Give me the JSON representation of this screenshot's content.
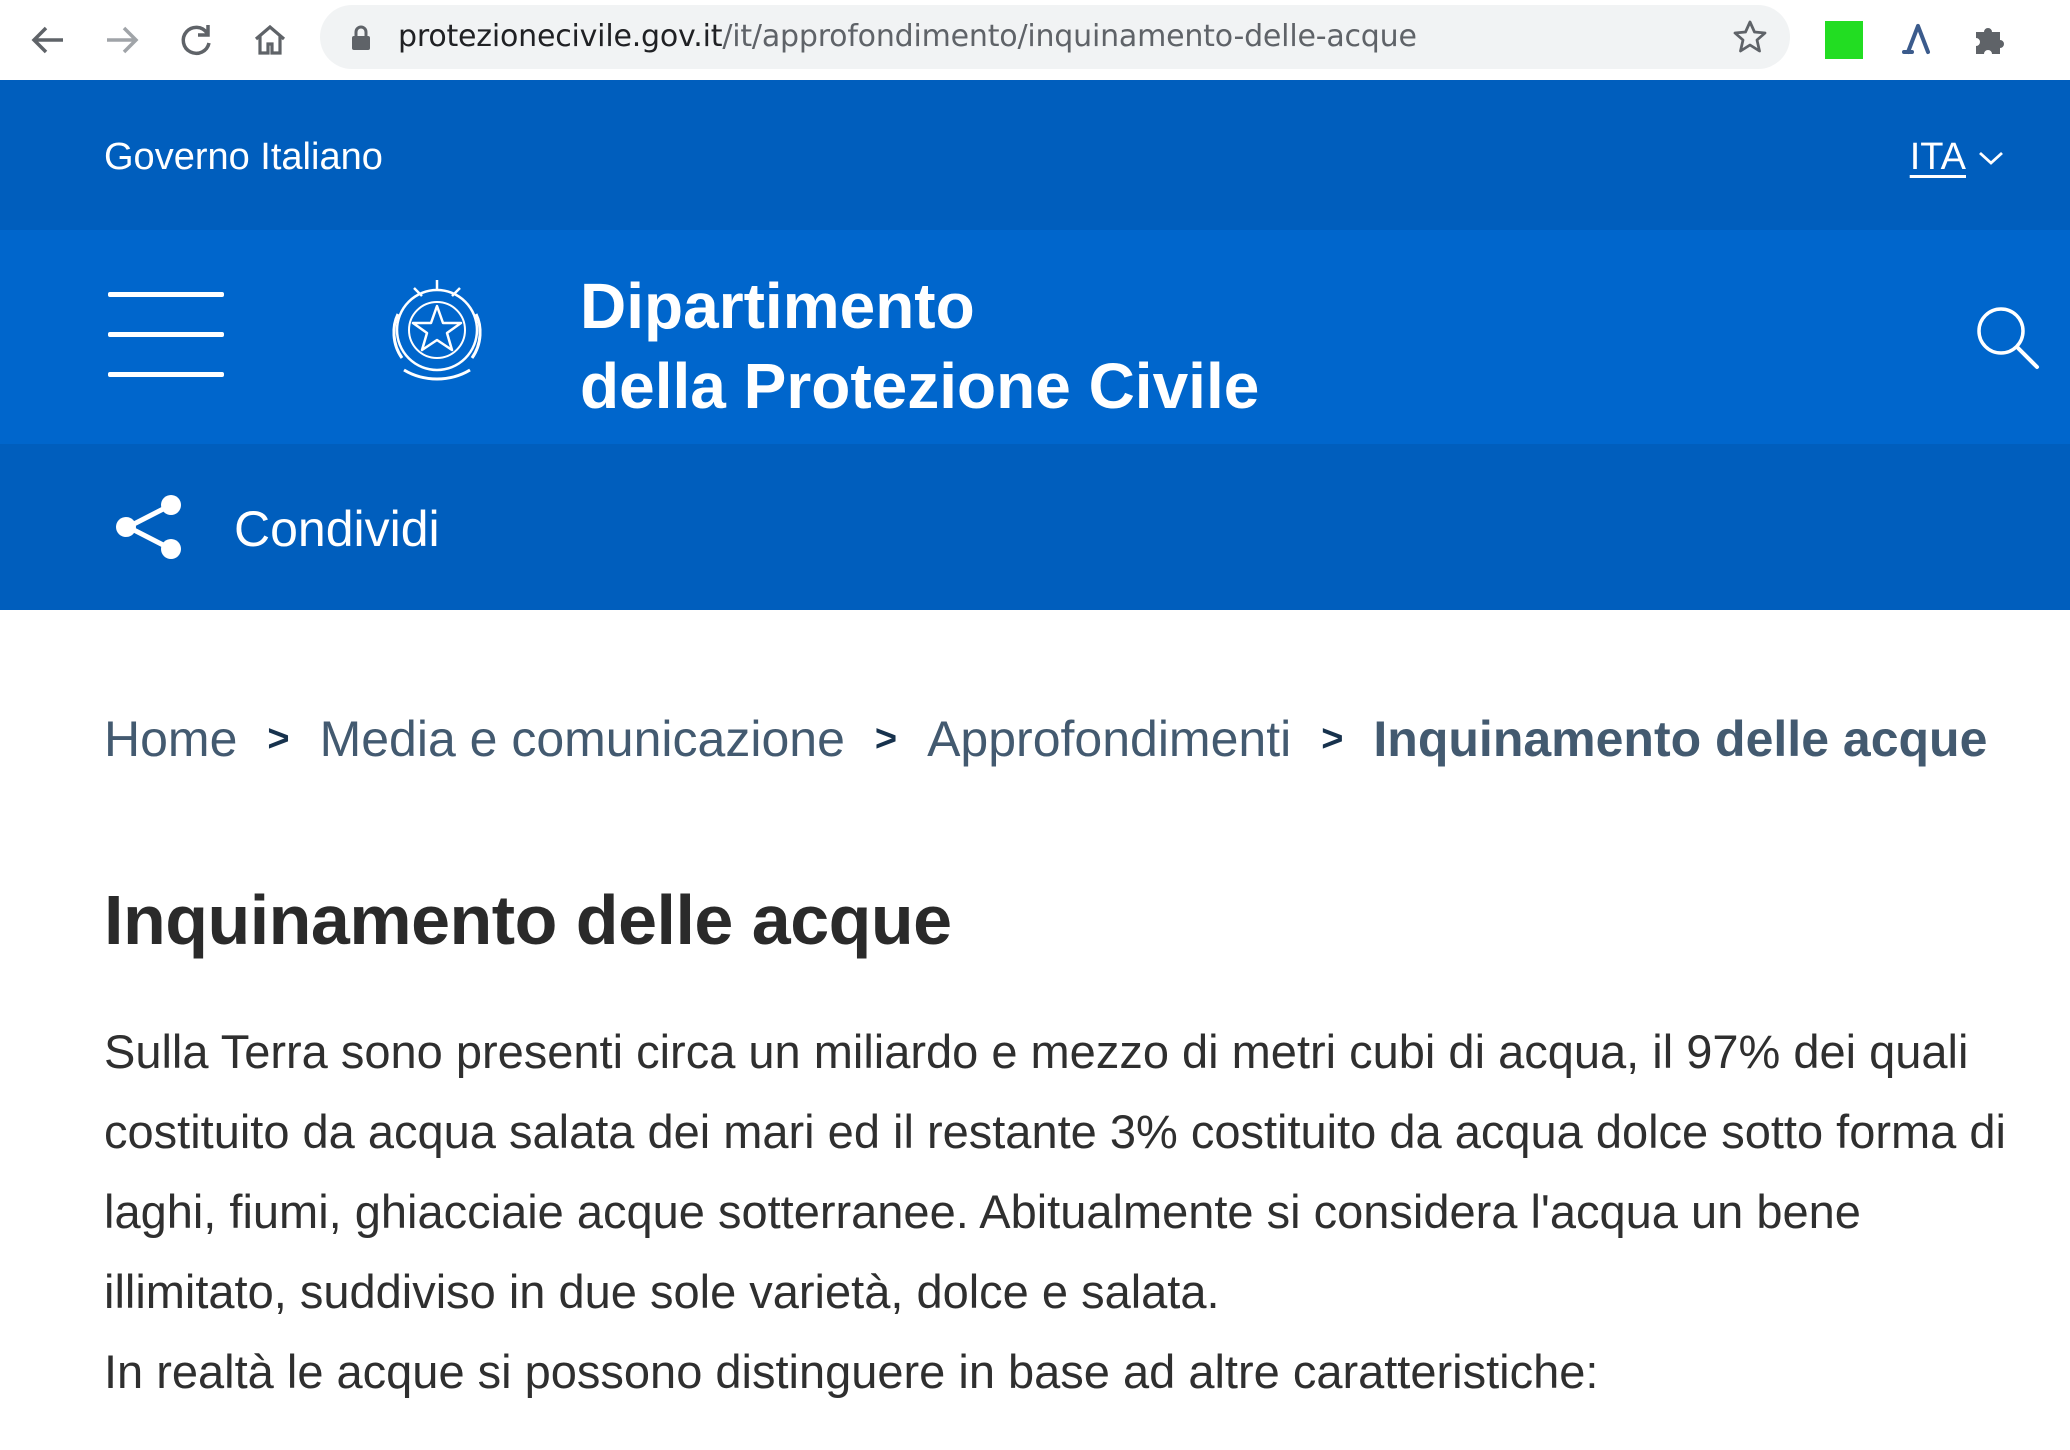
{
  "browser": {
    "url_domain": "protezionecivile.gov.it",
    "url_path": "/it/approfondimento/inquinamento-delle-acque",
    "ext_color": "#22dd22"
  },
  "gov_bar": {
    "label": "Governo Italiano",
    "language": "ITA"
  },
  "header": {
    "title_line1": "Dipartimento",
    "title_line2": "della Protezione Civile"
  },
  "share": {
    "label": "Condividi"
  },
  "breadcrumb": {
    "items": [
      "Home",
      "Media e comunicazione",
      "Approfondimenti",
      "Inquinamento delle acque"
    ],
    "separator": ">"
  },
  "main": {
    "title": "Inquinamento delle acque",
    "paragraph1": "Sulla Terra sono presenti circa un miliardo e mezzo di metri cubi di acqua, il 97% dei quali costituito da acqua salata dei mari ed il restante 3% costituito da acqua dolce sotto forma di laghi, fiumi, ghiacciaie acque sotterranee. Abitualmente si considera l'acqua un bene illimitato, suddiviso in due sole varietà, dolce e salata.",
    "paragraph2": "In realtà le acque si possono distinguere in base ad altre caratteristiche:"
  },
  "colors": {
    "gov_bar": "#005ebd",
    "header": "#0066cc",
    "breadcrumb_text": "#435a70"
  }
}
